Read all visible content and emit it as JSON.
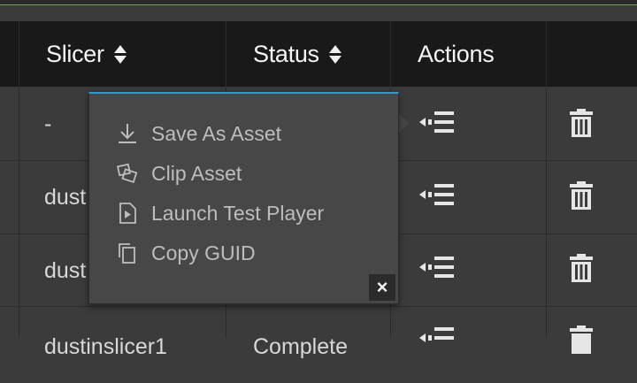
{
  "table": {
    "columns": [
      {
        "label": "Slicer",
        "sortable": true
      },
      {
        "label": "Status",
        "sortable": true
      },
      {
        "label": "Actions",
        "sortable": false
      }
    ],
    "rows": [
      {
        "slicer": "-",
        "status": ""
      },
      {
        "slicer": "dust",
        "status": ""
      },
      {
        "slicer": "dust",
        "status": ""
      },
      {
        "slicer": "dustinslicer1",
        "status": "Complete"
      }
    ]
  },
  "popup": {
    "items": [
      {
        "label": "Save As Asset",
        "icon": "download-icon"
      },
      {
        "label": "Clip Asset",
        "icon": "clip-icon"
      },
      {
        "label": "Launch Test Player",
        "icon": "play-file-icon"
      },
      {
        "label": "Copy GUID",
        "icon": "copy-icon"
      }
    ],
    "close_label": "×"
  },
  "colors": {
    "accent": "#2d9ad0",
    "header_bg": "#191919",
    "row_bg": "#3b3b3b",
    "popup_bg": "#474747",
    "top_border": "#b58a1a"
  }
}
